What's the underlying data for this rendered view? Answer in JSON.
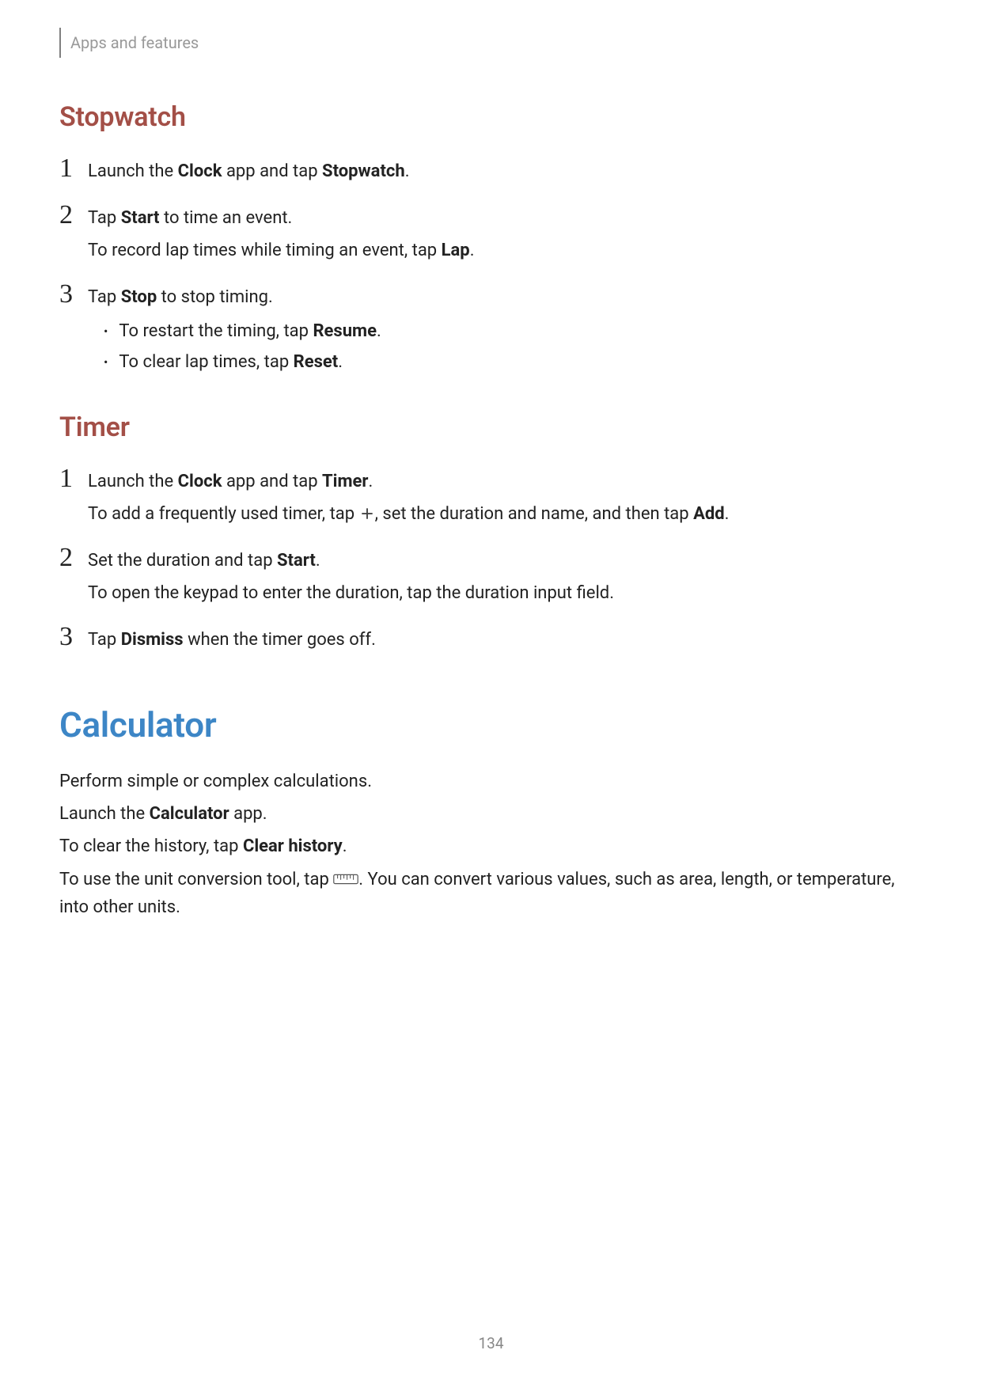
{
  "breadcrumb": "Apps and features",
  "stopwatch": {
    "heading": "Stopwatch",
    "step1": {
      "pre": "Launch the ",
      "b1": "Clock",
      "mid": " app and tap ",
      "b2": "Stopwatch",
      "post": "."
    },
    "step2": {
      "line1_pre": "Tap ",
      "line1_b": "Start",
      "line1_post": " to time an event.",
      "line2_pre": "To record lap times while timing an event, tap ",
      "line2_b": "Lap",
      "line2_post": "."
    },
    "step3": {
      "line1_pre": "Tap ",
      "line1_b": "Stop",
      "line1_post": " to stop timing.",
      "bullet1_pre": "To restart the timing, tap ",
      "bullet1_b": "Resume",
      "bullet1_post": ".",
      "bullet2_pre": "To clear lap times, tap ",
      "bullet2_b": "Reset",
      "bullet2_post": "."
    }
  },
  "timer": {
    "heading": "Timer",
    "step1": {
      "line1_pre": "Launch the ",
      "line1_b1": "Clock",
      "line1_mid": " app and tap ",
      "line1_b2": "Timer",
      "line1_post": ".",
      "line2_pre": "To add a frequently used timer, tap ",
      "line2_mid": ", set the duration and name, and then tap ",
      "line2_b": "Add",
      "line2_post": "."
    },
    "step2": {
      "line1_pre": "Set the duration and tap ",
      "line1_b": "Start",
      "line1_post": ".",
      "line2": "To open the keypad to enter the duration, tap the duration input field."
    },
    "step3": {
      "pre": "Tap ",
      "b": "Dismiss",
      "post": " when the timer goes off."
    }
  },
  "calculator": {
    "heading": "Calculator",
    "p1": "Perform simple or complex calculations.",
    "p2_pre": "Launch the ",
    "p2_b": "Calculator",
    "p2_post": " app.",
    "p3_pre": "To clear the history, tap ",
    "p3_b": "Clear history",
    "p3_post": ".",
    "p4_pre": "To use the unit conversion tool, tap ",
    "p4_post": ". You can convert various values, such as area, length, or temperature, into other units."
  },
  "pageNumber": "134"
}
